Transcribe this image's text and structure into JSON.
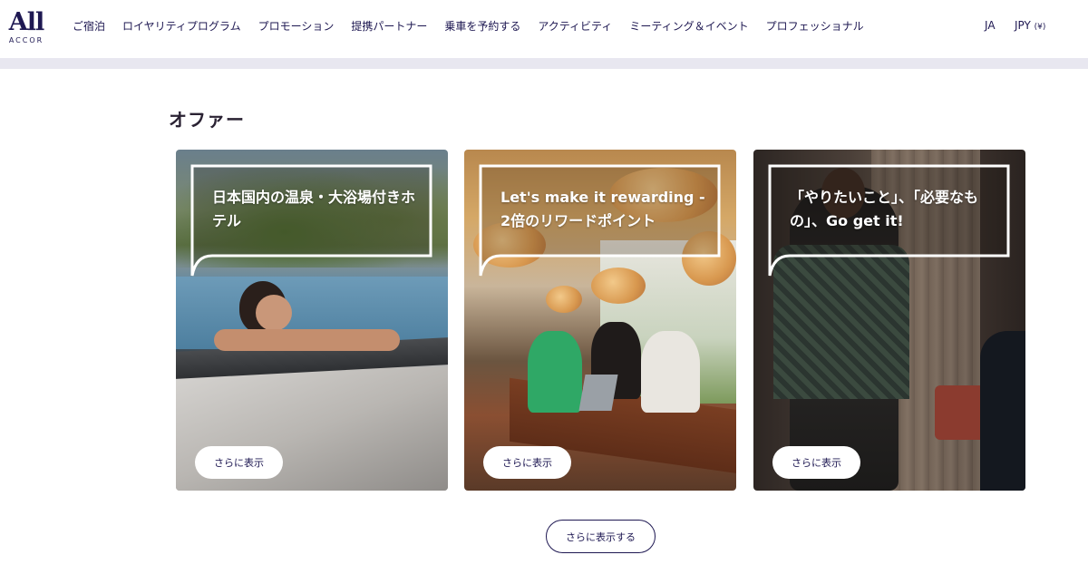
{
  "header": {
    "logo_main": "All",
    "logo_sub": "ACCOR",
    "nav": [
      {
        "label": "ご宿泊"
      },
      {
        "label": "ロイヤリティプログラム"
      },
      {
        "label": "プロモーション"
      },
      {
        "label": "提携パートナー"
      },
      {
        "label": "乗車を予約する"
      },
      {
        "label": "アクティビティ"
      },
      {
        "label": "ミーティング＆イベント"
      },
      {
        "label": "プロフェッショナル"
      }
    ],
    "language": "JA",
    "currency": "JPY",
    "currency_symbol": "(¥)"
  },
  "section": {
    "title": "オファー",
    "cards": [
      {
        "title": "日本国内の温泉・大浴場付きホテル",
        "button": "さらに表示"
      },
      {
        "title": "Let's make it rewarding - 2倍のリワードポイント",
        "button": "さらに表示"
      },
      {
        "title": "「やりたいこと」、「必要なもの」、Go get it!",
        "button": "さらに表示"
      }
    ],
    "show_more": "さらに表示する"
  },
  "colors": {
    "brand": "#1e1852",
    "band": "#e8e7f0"
  }
}
